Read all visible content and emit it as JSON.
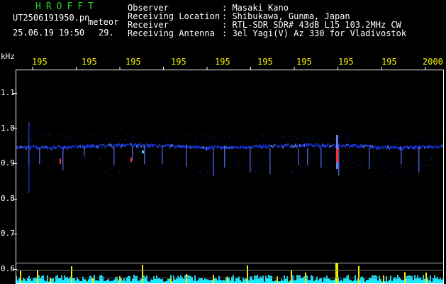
{
  "app_name": "HROFFT",
  "file": {
    "name": "UT2506191950.pn",
    "tag": "meteor",
    "date_time": "25.06.19 19:50",
    "extra": "29."
  },
  "info": {
    "labels": [
      "Observer",
      "Receiving Location",
      "Receiver",
      "Receiving Antenna"
    ],
    "values": [
      ": Masaki Kano",
      ": Shibukawa, Gunma, Japan",
      ": RTL-SDR SDR# 43dB L15 103.2MHz CW",
      ": 3el Yagi(V) Az 330 for Vladivostok"
    ]
  },
  "axis": {
    "unit": "kHz",
    "time_ticks": [
      "195",
      "195",
      "195",
      "195",
      "195",
      "195",
      "195",
      "195",
      "195",
      "2000"
    ],
    "freq_ticks": [
      "1.1",
      "1.0",
      "0.9",
      "0.8",
      "0.7",
      "0.6"
    ]
  },
  "colors": {
    "background": "#000000",
    "header_text": "#ffffff",
    "app_name": "#25d025",
    "tick_text": "#f5f000",
    "band": "#1a3cff",
    "meteor": "#ff3030",
    "spectrum": "#19e6ff"
  }
}
